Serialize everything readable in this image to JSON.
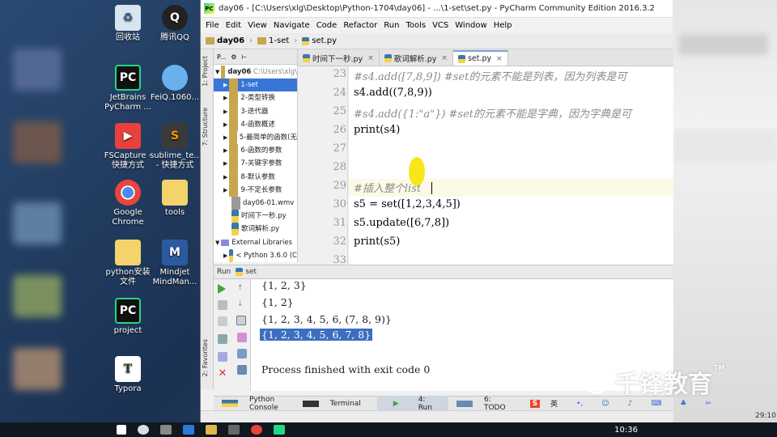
{
  "desktop": {
    "icons": [
      {
        "label": "回收站",
        "icon": "recycle-bin-icon"
      },
      {
        "label": "腾讯QQ",
        "icon": "qq-penguin-icon"
      },
      {
        "label": "JetBrains PyCharm ...",
        "icon": "pycharm-icon"
      },
      {
        "label": "FeiQ.1060...",
        "icon": "feiq-icon"
      },
      {
        "label": "FSCapture - 快捷方式",
        "icon": "fscapture-icon"
      },
      {
        "label": "sublime_te... - 快捷方式",
        "icon": "sublime-icon"
      },
      {
        "label": "Google Chrome",
        "icon": "chrome-icon"
      },
      {
        "label": "tools",
        "icon": "folder-icon"
      },
      {
        "label": "python安装文件",
        "icon": "folder-icon"
      },
      {
        "label": "Mindjet MindMan...",
        "icon": "mindjet-icon"
      },
      {
        "label": "project",
        "icon": "pycharm-project-icon"
      },
      {
        "label": "Typora",
        "icon": "typora-icon"
      }
    ]
  },
  "window": {
    "title": "day06 - [C:\\Users\\xlg\\Desktop\\Python-1704\\day06] - ...\\1-set\\set.py - PyCharm Community Edition 2016.3.2",
    "menu": [
      "File",
      "Edit",
      "View",
      "Navigate",
      "Code",
      "Refactor",
      "Run",
      "Tools",
      "VCS",
      "Window",
      "Help"
    ],
    "breadcrumb": [
      "day06",
      "1-set",
      "set.py"
    ]
  },
  "project": {
    "header_dropdown": "P...",
    "side_tabs": [
      "1: Project",
      "7: Structure",
      "2: Favorites"
    ],
    "root_label": "day06",
    "root_path": "C:\\Users\\xlg\\",
    "items": [
      "1-set",
      "2-类型转换",
      "3-迭代器",
      "4-函数概述",
      "5-最简单的函数(无",
      "6-函数的参数",
      "7-关键字参数",
      "8-默认参数",
      "9-不定长参数",
      "day06-01.wmv",
      "时间下一秒.py",
      "歌词解析.py"
    ],
    "external": "External Libraries",
    "python": "< Python 3.6.0 (C"
  },
  "editor": {
    "tabs": [
      "时间下一秒.py",
      "歌词解析.py",
      "set.py"
    ],
    "lines": [
      {
        "n": "23",
        "text": "#s4.add([7,8,9]) #set的元素不能是列表，因为列表是可",
        "comment": true
      },
      {
        "n": "24",
        "text": "s4.add((7,8,9))",
        "comment": false
      },
      {
        "n": "25",
        "text": "#s4.add({1:\"a\"}) #set的元素不能是字典，因为字典是可",
        "comment": true
      },
      {
        "n": "26",
        "text": "print(s4)",
        "comment": false
      },
      {
        "n": "27",
        "text": "",
        "comment": false
      },
      {
        "n": "28",
        "text": "",
        "comment": false
      },
      {
        "n": "29",
        "text": "#插入整个list",
        "comment": true
      },
      {
        "n": "30",
        "text": "s5 = set([1,2,3,4,5])",
        "comment": false
      },
      {
        "n": "31",
        "text": "s5.update([6,7,8])",
        "comment": false
      },
      {
        "n": "32",
        "text": "print(s5)",
        "comment": false
      },
      {
        "n": "33",
        "text": "",
        "comment": false
      }
    ]
  },
  "run": {
    "title": "Run",
    "config": "set",
    "output": [
      "{1, 2, 3}",
      "{1, 2}",
      "{1, 2, 3, 4, 5, 6, (7, 8, 9)}",
      "{1, 2, 3, 4, 5, 6, 7, 8}",
      "",
      "Process finished with exit code 0"
    ]
  },
  "bottom_tabs": [
    "Python Console",
    "Terminal",
    "4: Run",
    "6: TODO"
  ],
  "ime": {
    "lang": "英"
  },
  "clock": "10:36",
  "watermark": "千锋教育",
  "status_right": "29:10"
}
